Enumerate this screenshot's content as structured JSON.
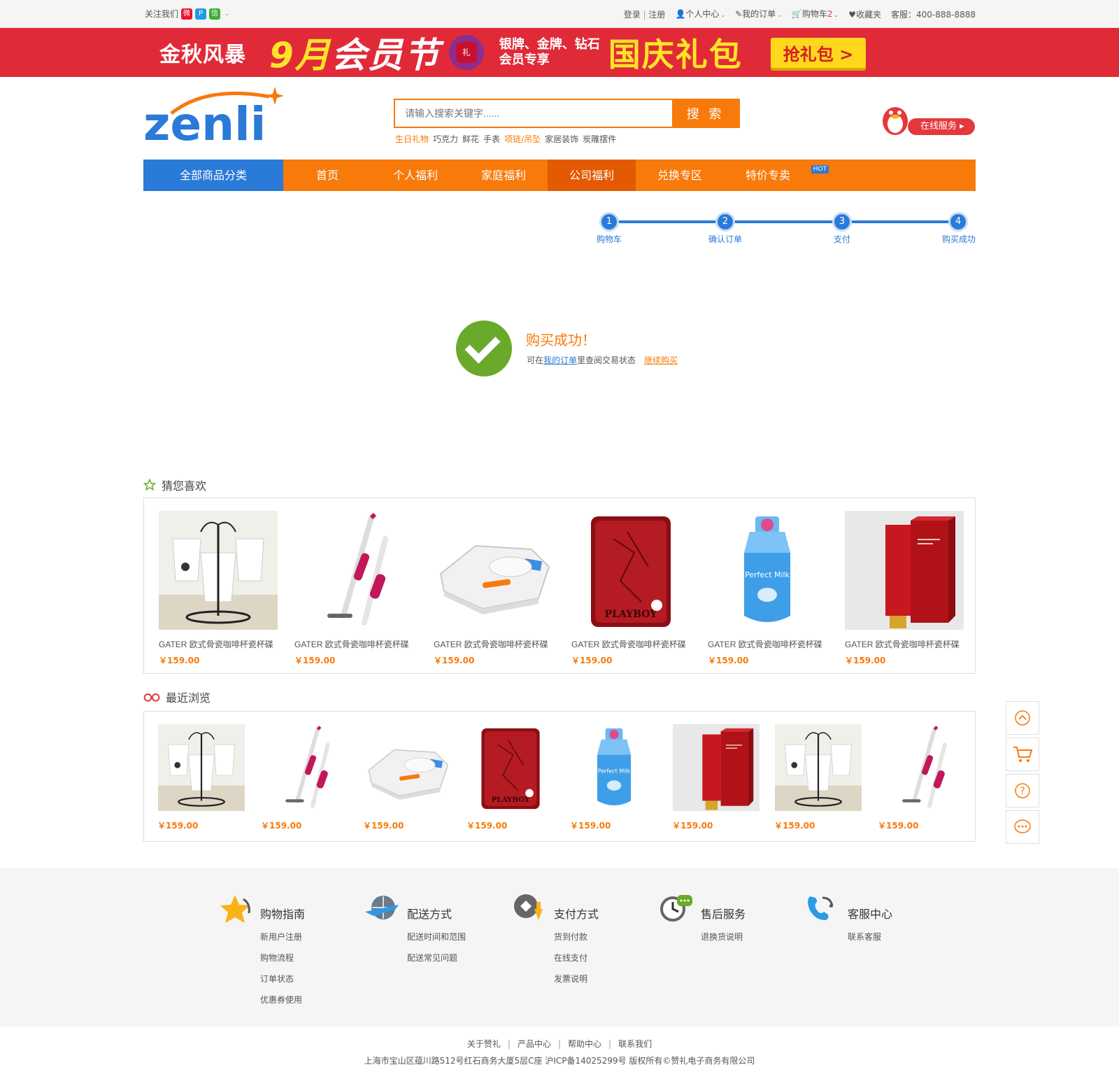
{
  "topbar": {
    "follow_label": "关注我们",
    "login": "登录",
    "register": "注册",
    "user_center": "个人中心",
    "my_orders": "我的订单",
    "cart": "购物车",
    "cart_count": "2",
    "favorites": "收藏夹",
    "hotline": "客服：400-888-8888"
  },
  "banner": {
    "brand": "金秋风暴",
    "title_highlight": "9月",
    "title_rest": "会员节",
    "gift_glyph": "礼",
    "sub_line1": "银牌、金牌、钻石",
    "sub_line2": "会员专享",
    "main": "国庆礼包",
    "cta": "抢礼包 >"
  },
  "logo": {
    "text": "zenli"
  },
  "search": {
    "placeholder": "请输入搜索关键字......",
    "button": "搜 索",
    "hotwords": [
      {
        "text": "生日礼物",
        "highlight": true
      },
      {
        "text": "巧克力",
        "highlight": false
      },
      {
        "text": "鲜花",
        "highlight": false
      },
      {
        "text": "手表",
        "highlight": false
      },
      {
        "text": "项链/吊坠",
        "highlight": true
      },
      {
        "text": "家居装饰",
        "highlight": false
      },
      {
        "text": "炭雕摆件",
        "highlight": false
      }
    ]
  },
  "service": {
    "label": "在线服务"
  },
  "nav": {
    "all_categories": "全部商品分类",
    "items": [
      "首页",
      "个人福利",
      "家庭福利",
      "公司福利",
      "兑换专区",
      "特价专卖"
    ],
    "active_index": 3,
    "hot_badge": "HOT"
  },
  "steps": [
    "购物车",
    "确认订单",
    "支付",
    "购买成功"
  ],
  "step_numbers": [
    "1",
    "2",
    "3",
    "4"
  ],
  "success": {
    "title": "购买成功！",
    "prefix": "可在",
    "link": "我的订单",
    "suffix": "里查阅交易状态",
    "continue": "继续购买"
  },
  "guess": {
    "title": "猜您喜欢",
    "products": [
      {
        "name": "GATER 欧式骨瓷咖啡杯瓷杯碟",
        "price": "￥159.00",
        "kind": "cups"
      },
      {
        "name": "GATER 欧式骨瓷咖啡杯瓷杯碟",
        "price": "￥159.00",
        "kind": "vacuum"
      },
      {
        "name": "GATER 欧式骨瓷咖啡杯瓷杯碟",
        "price": "￥159.00",
        "kind": "robot"
      },
      {
        "name": "GATER 欧式骨瓷咖啡杯瓷杯碟",
        "price": "￥159.00",
        "kind": "lighter"
      },
      {
        "name": "GATER 欧式骨瓷咖啡杯瓷杯碟",
        "price": "￥159.00",
        "kind": "milk"
      },
      {
        "name": "GATER 欧式骨瓷咖啡杯瓷杯碟",
        "price": "￥159.00",
        "kind": "tube"
      }
    ]
  },
  "recent": {
    "title": "最近浏览",
    "products": [
      {
        "price": "￥159.00",
        "kind": "cups"
      },
      {
        "price": "￥159.00",
        "kind": "vacuum"
      },
      {
        "price": "￥159.00",
        "kind": "robot"
      },
      {
        "price": "￥159.00",
        "kind": "lighter"
      },
      {
        "price": "￥159.00",
        "kind": "milk"
      },
      {
        "price": "￥159.00",
        "kind": "tube"
      },
      {
        "price": "￥159.00",
        "kind": "cups"
      },
      {
        "price": "￥159.00",
        "kind": "vacuum"
      }
    ]
  },
  "product_labels": {
    "lighter_brand": "PLAYBOY",
    "milk_label": "Perfect Milk"
  },
  "footer": {
    "columns": [
      {
        "title": "购物指南",
        "icon": "star-icon",
        "links": [
          "新用户注册",
          "购物流程",
          "订单状态",
          "优惠券使用"
        ]
      },
      {
        "title": "配送方式",
        "icon": "plane-globe-icon",
        "links": [
          "配送时间和范围",
          "配送常见问题"
        ]
      },
      {
        "title": "支付方式",
        "icon": "payment-icon",
        "links": [
          "货到付款",
          "在线支付",
          "发票说明"
        ]
      },
      {
        "title": "售后服务",
        "icon": "clock-chat-icon",
        "links": [
          "退换货说明"
        ]
      },
      {
        "title": "客服中心",
        "icon": "phone-icon",
        "links": [
          "联系客服"
        ]
      }
    ],
    "bottom_links": [
      "关于赞礼",
      "产品中心",
      "帮助中心",
      "联系我们"
    ],
    "copyright": "上海市宝山区蕴川路512号红石商务大厦5层C座  沪ICP备14025299号  版权所有©赞礼电子商务有限公司"
  },
  "colors": {
    "orange": "#f77a0b",
    "blue": "#2a7ad8",
    "red": "#e12a38",
    "green": "#6aaa2b"
  }
}
